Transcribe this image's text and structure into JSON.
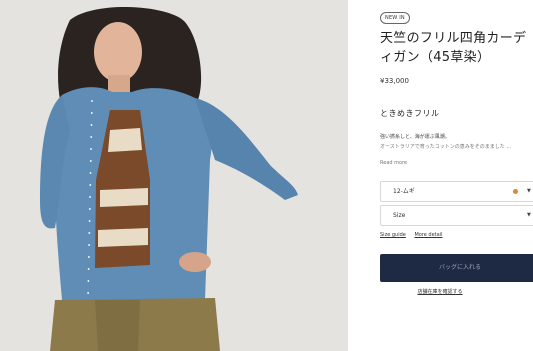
{
  "product": {
    "badge": "NEW IN",
    "title": "天竺のフリル四角カーディガン（45草染）",
    "price": "¥33,000",
    "subtitle": "ときめきフリル",
    "description_line1": "強い撚糸しと、海が運ぶ風潮。",
    "description_line2": "オーストラリアで育ったコットンの恵みをそのまました ...",
    "read_more": "Read more"
  },
  "options": {
    "color_value": "12-ムギ",
    "swatch_color": "#d98a2e",
    "size_value": "Size"
  },
  "links": {
    "size_guide": "Size guide",
    "more_detail": "More detail"
  },
  "actions": {
    "add_to_bag": "バッグに入れる",
    "check_store_stock": "店舗在庫を確認する"
  },
  "colors": {
    "button_bg": "#1e2a44",
    "cardigan_blue": "#5f8db5"
  }
}
